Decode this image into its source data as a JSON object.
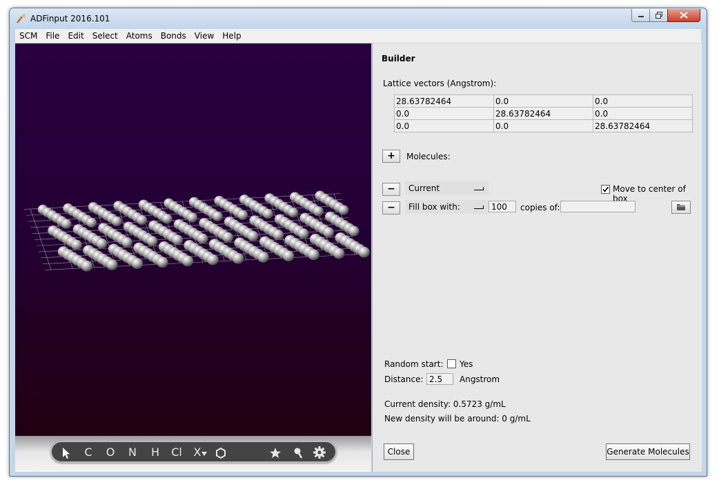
{
  "window": {
    "title": "ADFinput 2016.101"
  },
  "menu": [
    "SCM",
    "File",
    "Edit",
    "Select",
    "Atoms",
    "Bonds",
    "View",
    "Help"
  ],
  "toolbar": {
    "tools": [
      "C",
      "O",
      "N",
      "H",
      "Cl",
      "X"
    ]
  },
  "builder": {
    "title": "Builder",
    "lattice_label": "Lattice vectors (Angstrom):",
    "lattice": [
      [
        "28.63782464",
        "0.0",
        "0.0"
      ],
      [
        "0.0",
        "28.63782464",
        "0.0"
      ],
      [
        "0.0",
        "0.0",
        "28.63782464"
      ]
    ],
    "add_symbol": "+",
    "remove_symbol": "−",
    "molecules_label": "Molecules:",
    "row1": {
      "dropdown": "Current",
      "move_to_center_label": "Move to center of box",
      "move_to_center_checked": true
    },
    "row2": {
      "dropdown": "Fill box with:",
      "count": "100",
      "copies_label": "copies of:",
      "copies_value": ""
    },
    "random_start_label": "Random start:",
    "random_yes_label": "Yes",
    "random_checked": false,
    "distance_label": "Distance:",
    "distance_value": "2.5",
    "distance_unit": "Angstrom",
    "current_density": "Current density: 0.5723 g/mL",
    "new_density": "New density will be around: 0 g/mL",
    "close_label": "Close",
    "generate_label": "Generate Molecules"
  }
}
